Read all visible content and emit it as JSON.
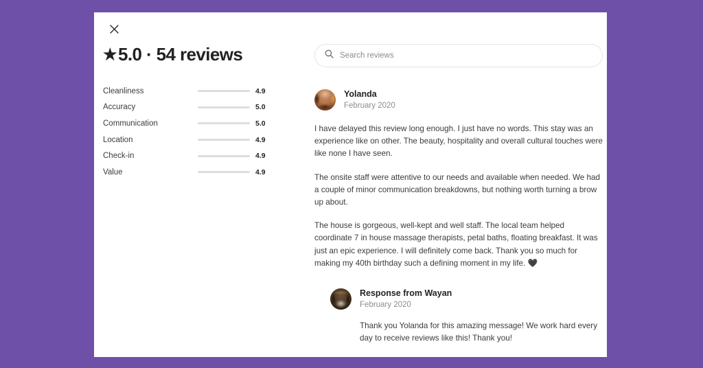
{
  "page": {
    "background_color": "#6E50A8",
    "card_background": "#FFFFFF"
  },
  "modal": {
    "close_label": "Close",
    "close_icon": "close-x-icon"
  },
  "summary": {
    "star_glyph": "★",
    "title": "5.0 · 54 reviews",
    "rating_value": "5.0",
    "review_count": "54 reviews",
    "breakdown": [
      {
        "label": "Cleanliness",
        "value": "4.9",
        "fill_percent": 98
      },
      {
        "label": "Accuracy",
        "value": "5.0",
        "fill_percent": 100
      },
      {
        "label": "Communication",
        "value": "5.0",
        "fill_percent": 100
      },
      {
        "label": "Location",
        "value": "4.9",
        "fill_percent": 98
      },
      {
        "label": "Check-in",
        "value": "4.9",
        "fill_percent": 98
      },
      {
        "label": "Value",
        "value": "4.9",
        "fill_percent": 98
      }
    ]
  },
  "search": {
    "icon": "search-magnifier-icon",
    "placeholder": "Search reviews",
    "value": ""
  },
  "review": {
    "avatar_icon": "guest-avatar-photo",
    "author": "Yolanda",
    "date": "February 2020",
    "paragraphs": [
      "I have delayed this review long enough. I just have no words. This stay was an experience like on other. The beauty, hospitality and overall cultural touches were like none I have seen.",
      "The onsite staff were attentive to our needs and available when needed. We had a couple of minor communication breakdowns, but nothing worth turning a brow up about.",
      "The house is gorgeous, well-kept and well staff. The local team helped coordinate 7 in house massage therapists, petal baths, floating breakfast. It was just an epic experience. I will definitely come back. Thank you so much for making my 40th birthday such a defining moment in my life. 🖤"
    ]
  },
  "response": {
    "avatar_icon": "host-avatar-photo",
    "title": "Response from Wayan",
    "date": "February 2020",
    "text": "Thank you Yolanda for this amazing message! We work hard every day to receive reviews like this! Thank you!"
  }
}
